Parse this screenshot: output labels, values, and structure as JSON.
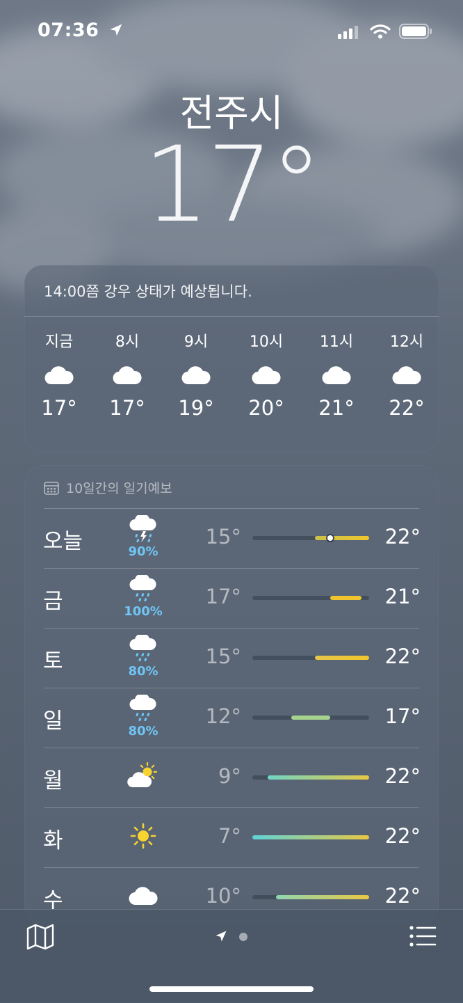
{
  "status_bar": {
    "time": "07:36"
  },
  "location": {
    "city": "전주시",
    "temperature": "17°"
  },
  "hourly": {
    "summary": "14:00쯤 강우 상태가 예상됩니다.",
    "items": [
      {
        "label": "지금",
        "icon": "cloud-icon",
        "temp": "17°"
      },
      {
        "label": "8시",
        "icon": "cloud-icon",
        "temp": "17°"
      },
      {
        "label": "9시",
        "icon": "cloud-icon",
        "temp": "19°"
      },
      {
        "label": "10시",
        "icon": "cloud-icon",
        "temp": "20°"
      },
      {
        "label": "11시",
        "icon": "cloud-icon",
        "temp": "21°"
      },
      {
        "label": "12시",
        "icon": "cloud-icon",
        "temp": "22°"
      }
    ]
  },
  "daily": {
    "header": "10일간의 일기예보",
    "range_min": 7,
    "range_max": 22,
    "days": [
      {
        "day": "오늘",
        "icon": "thunderstorm-icon",
        "precip": "90%",
        "low": "15°",
        "high": "22°",
        "low_val": 15,
        "high_val": 22,
        "current_val": 17,
        "grad": [
          "#c9c24a",
          "#f0c62c"
        ]
      },
      {
        "day": "금",
        "icon": "rain-icon",
        "precip": "100%",
        "low": "17°",
        "high": "21°",
        "low_val": 17,
        "high_val": 21,
        "grad": [
          "#f0c42c",
          "#f0c42c"
        ]
      },
      {
        "day": "토",
        "icon": "rain-icon",
        "precip": "80%",
        "low": "15°",
        "high": "22°",
        "low_val": 15,
        "high_val": 22,
        "grad": [
          "#e6c64a",
          "#f0c62c"
        ]
      },
      {
        "day": "일",
        "icon": "rain-icon",
        "precip": "80%",
        "low": "12°",
        "high": "17°",
        "low_val": 12,
        "high_val": 17,
        "grad": [
          "#a6d38e",
          "#a6d38e"
        ]
      },
      {
        "day": "월",
        "icon": "partly-sunny-icon",
        "precip": "",
        "low": "9°",
        "high": "22°",
        "low_val": 9,
        "high_val": 22,
        "grad": [
          "#6fd6c4",
          "#e8c843"
        ]
      },
      {
        "day": "화",
        "icon": "sun-icon",
        "precip": "",
        "low": "7°",
        "high": "22°",
        "low_val": 7,
        "high_val": 22,
        "grad": [
          "#5fd3d6",
          "#e8c843"
        ]
      },
      {
        "day": "수",
        "icon": "cloud-icon",
        "precip": "",
        "low": "10°",
        "high": "22°",
        "low_val": 10,
        "high_val": 22,
        "grad": [
          "#8fd6b0",
          "#e8c843"
        ]
      }
    ]
  },
  "toolbar": {
    "map_icon": "map-icon",
    "location_icon": "location-arrow-icon",
    "list_icon": "list-icon"
  }
}
